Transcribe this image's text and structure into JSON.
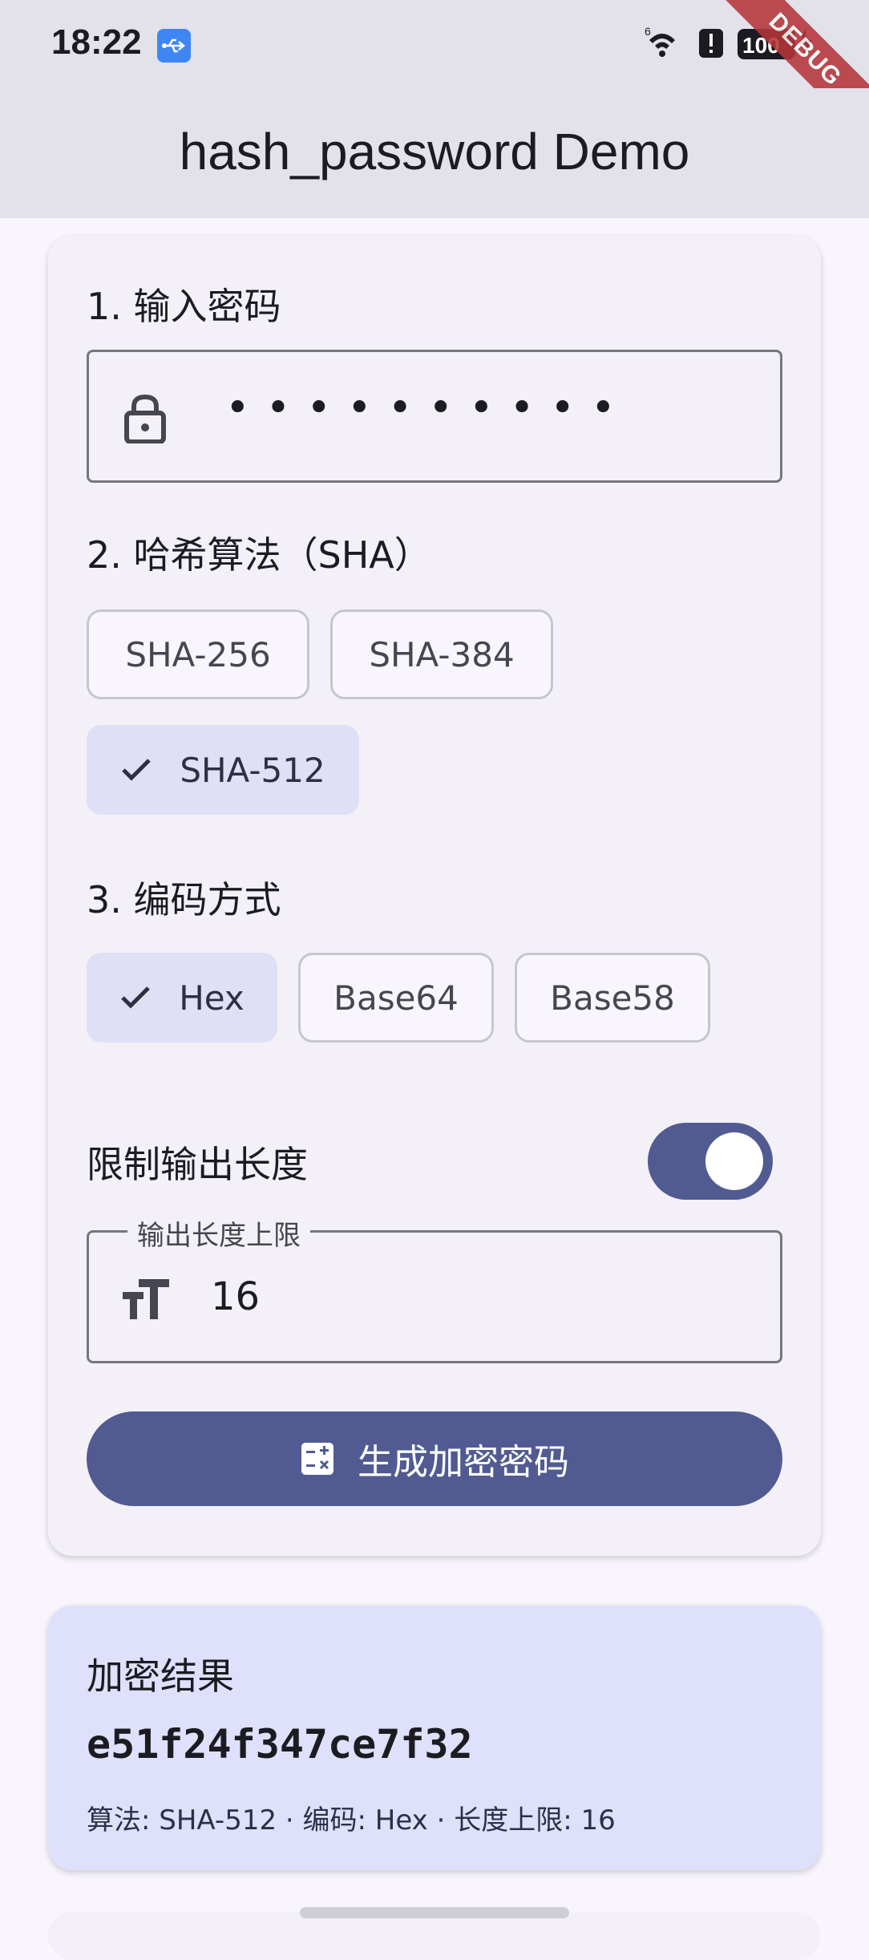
{
  "status_bar": {
    "time": "18:22",
    "battery": "100",
    "icons": [
      "usb-icon",
      "wifi-icon",
      "alert-icon",
      "battery-icon",
      "charging-icon"
    ]
  },
  "debug_banner": "DEBUG",
  "app_bar": {
    "title": "hash_password Demo"
  },
  "settings": {
    "password_section_label": "1. 输入密码",
    "password_mask": "••••••••••",
    "algorithm_section_label": "2. 哈希算法（SHA）",
    "algorithms": [
      {
        "label": "SHA-256",
        "selected": false
      },
      {
        "label": "SHA-384",
        "selected": false
      },
      {
        "label": "SHA-512",
        "selected": true
      }
    ],
    "encoding_section_label": "3. 编码方式",
    "encodings": [
      {
        "label": "Hex",
        "selected": true
      },
      {
        "label": "Base64",
        "selected": false
      },
      {
        "label": "Base58",
        "selected": false
      }
    ],
    "limit_length_label": "限制输出长度",
    "limit_length_enabled": true,
    "max_length_field_label": "输出长度上限",
    "max_length_value": "16",
    "generate_button_label": "生成加密密码"
  },
  "result": {
    "title": "加密结果",
    "hash": "e51f24f347ce7f32",
    "meta": "算法: SHA-512 · 编码: Hex · 长度上限: 16"
  },
  "colors": {
    "primary": "#515b92",
    "selected_chip": "#dfe0f6",
    "result_card": "#dfe0fc",
    "app_bar": "#e3e2ea"
  }
}
